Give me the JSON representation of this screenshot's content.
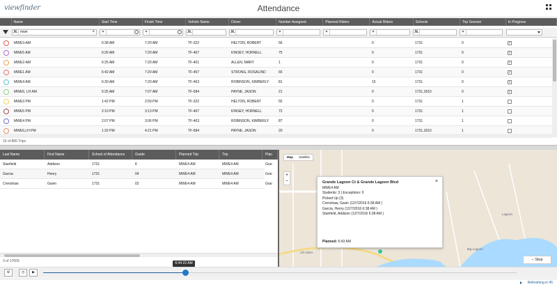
{
  "app": {
    "logo": "viewfinder",
    "title": "Attendance"
  },
  "main_table": {
    "columns": [
      "Name",
      "Start Time",
      "Finish Time",
      "Vehicle Name",
      "Driver",
      "Number Assigned",
      "Planned Riders",
      "Actual Riders",
      "Schools",
      "Trip Session",
      "In Progress"
    ],
    "filter_name_value": "mwe",
    "rows": [
      {
        "name": "MWE3-AM",
        "start": "6:38 AM",
        "finish": "7:20 AM",
        "vehicle": "TF-322",
        "driver": "HELTON, ROBERT",
        "assigned": "56",
        "planned": "",
        "actual": "0",
        "schools": "1731",
        "session": "0",
        "in_progress": true,
        "color": "#e05a5a"
      },
      {
        "name": "MWE5 AM",
        "start": "6:26 AM",
        "finish": "7:20 AM",
        "vehicle": "TF-467",
        "driver": "KINSEY, HORNELL",
        "assigned": "75",
        "planned": "",
        "actual": "0",
        "schools": "1731",
        "session": "0",
        "in_progress": true,
        "color": "#b06ad0"
      },
      {
        "name": "MWE2-AM",
        "start": "6:25 AM",
        "finish": "7:20 AM",
        "vehicle": "TF-401",
        "driver": "ALLEN, MARY",
        "assigned": "1",
        "planned": "",
        "actual": "0",
        "schools": "1731",
        "session": "0",
        "in_progress": true,
        "color": "#f0a050"
      },
      {
        "name": "MWE1 AM",
        "start": "6:42 AM",
        "finish": "7:20 AM",
        "vehicle": "TF-457",
        "driver": "STRONG, ROSALIND",
        "assigned": "65",
        "planned": "",
        "actual": "0",
        "schools": "1731",
        "session": "0",
        "in_progress": true,
        "color": "#e07070"
      },
      {
        "name": "MWE4 AM",
        "start": "6:30 AM",
        "finish": "7:20 AM",
        "vehicle": "TF-463",
        "driver": "ROBINSON, KIMBERLY",
        "assigned": "81",
        "planned": "",
        "actual": "15",
        "schools": "1731",
        "session": "0",
        "in_progress": true,
        "color": "#60c0d0"
      },
      {
        "name": "MWE6, LH AM",
        "start": "5:25 AM",
        "finish": "7:07 AM",
        "vehicle": "TF-584",
        "driver": "PAYNE, JASON",
        "assigned": "21",
        "planned": "",
        "actual": "0",
        "schools": "1731,1810",
        "session": "0",
        "in_progress": true,
        "color": "#90d080"
      },
      {
        "name": "MWE3 PM",
        "start": "1:42 PM",
        "finish": "2:59 PM",
        "vehicle": "TF-322",
        "driver": "HELTON, ROBERT",
        "assigned": "55",
        "planned": "",
        "actual": "0",
        "schools": "1731",
        "session": "1",
        "in_progress": false,
        "color": "#f0d060"
      },
      {
        "name": "MWE5 PM",
        "start": "2:10 PM",
        "finish": "3:13 PM",
        "vehicle": "TF-467",
        "driver": "KINSEY, HORNELL",
        "assigned": "72",
        "planned": "",
        "actual": "0",
        "schools": "1731",
        "session": "1",
        "in_progress": false,
        "color": "#a04a4a"
      },
      {
        "name": "MWE4 PM",
        "start": "2:07 PM",
        "finish": "3:06 PM",
        "vehicle": "TF-463",
        "driver": "ROBINSON, KIMBERLY",
        "assigned": "87",
        "planned": "",
        "actual": "0",
        "schools": "1731",
        "session": "1",
        "in_progress": false,
        "color": "#7070d0"
      },
      {
        "name": "MWE6,LH PM",
        "start": "1:32 PM",
        "finish": "4:21 PM",
        "vehicle": "TF-584",
        "driver": "PAYNE, JASON",
        "assigned": "20",
        "planned": "",
        "actual": "0",
        "schools": "1731,1810",
        "session": "1",
        "in_progress": false,
        "color": "#e09060"
      }
    ],
    "trips_count": "15 of 885 Trips"
  },
  "riders_table": {
    "columns": [
      "Last Name",
      "First Name",
      "School of Attendance",
      "Grade",
      "Planned Trip",
      "Trip",
      "Plan"
    ],
    "rows": [
      [
        "Stanfield",
        "Addison",
        "1731",
        "K",
        "MWE4 AM",
        "MWE4 AM",
        "Grar"
      ],
      [
        "Garcia",
        "Henry",
        "1731",
        "04",
        "MWE4 AM",
        "MWE4 AM",
        "Grar"
      ],
      [
        "Crenshaw",
        "Gavin",
        "1731",
        "02",
        "MWE4 AM",
        "MWE4 AM",
        "Grar"
      ]
    ],
    "count": "3 of 17609"
  },
  "map": {
    "tabs": [
      "Map",
      "Satellite"
    ],
    "popup": {
      "title": "Grande Lagoon Ct & Grande Lagoon Blvd",
      "trip": "MWE4 AM",
      "students": "Students: 3 | Exceptions: 0",
      "picked_up": "Picked Up (3)",
      "riders": [
        "Crenshaw, Gavin (12/7/2016 6:38 AM )",
        "Garcia, Henry (12/7/2016 6:38 AM )",
        "Stanfield, Addison (12/7/2016 6:38 AM )"
      ],
      "planned_label": "Planned:",
      "planned_value": "6:43 AM"
    },
    "stop_label": "Stop",
    "labels": [
      "Big Lagoon",
      "Lagoon",
      "CR-292A"
    ]
  },
  "playback": {
    "time": "6:44:22 AM",
    "progress": 0.3
  },
  "footer": {
    "refresh": "Refreshing in 45"
  }
}
